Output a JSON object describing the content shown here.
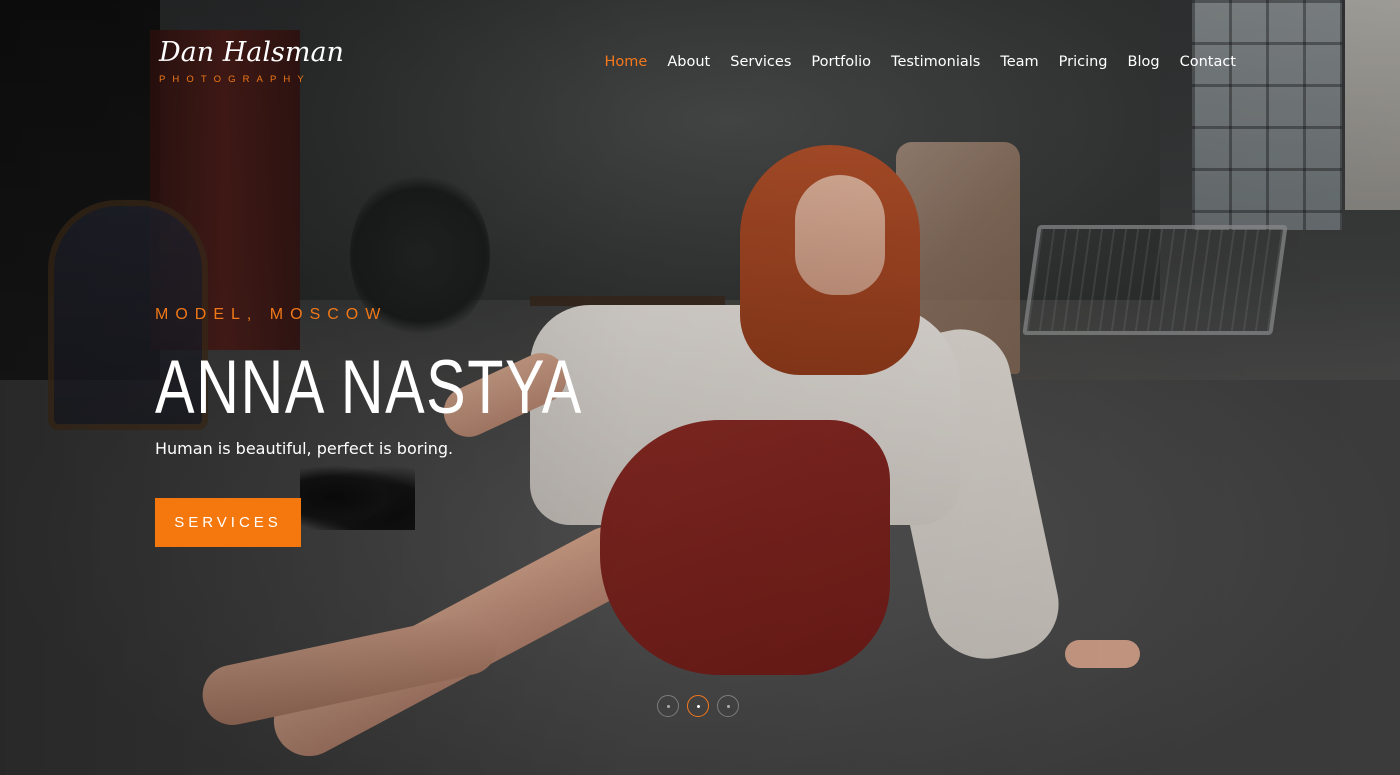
{
  "logo": {
    "script_text": "Dan Halsman",
    "sub_text": "PHOTOGRAPHY"
  },
  "nav": {
    "items": [
      {
        "label": "Home",
        "active": true
      },
      {
        "label": "About"
      },
      {
        "label": "Services"
      },
      {
        "label": "Portfolio"
      },
      {
        "label": "Testimonials"
      },
      {
        "label": "Team"
      },
      {
        "label": "Pricing"
      },
      {
        "label": "Blog"
      },
      {
        "label": "Contact"
      }
    ]
  },
  "hero": {
    "eyebrow": "MODEL, MOSCOW",
    "headline": "ANNA NASTYA",
    "tagline": "Human is beautiful, perfect is boring.",
    "cta_label": "SERVICES"
  },
  "slider": {
    "slide_count": 3,
    "active_index": 1
  },
  "colors": {
    "accent": "#f5781c",
    "text": "#ffffff"
  }
}
